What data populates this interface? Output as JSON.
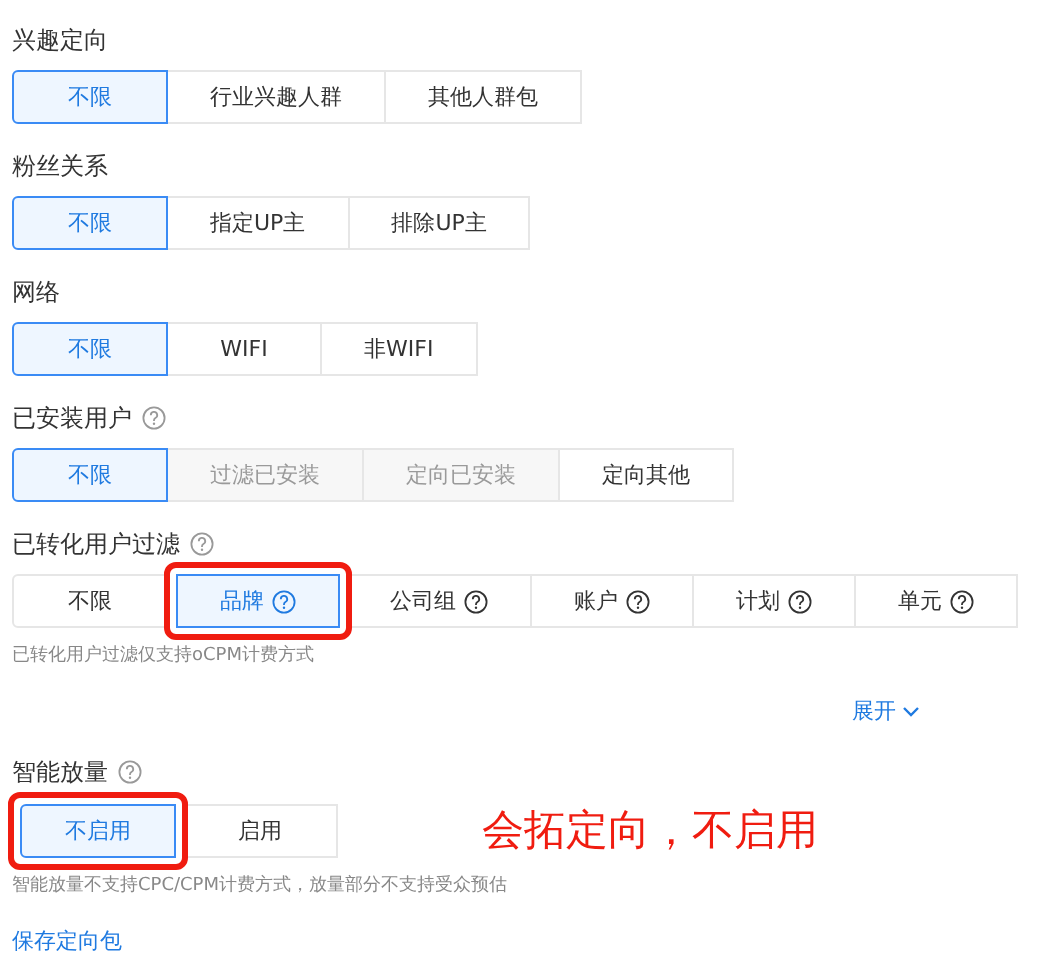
{
  "sections": [
    {
      "title": "兴趣定向",
      "help": false,
      "options": [
        {
          "label": "不限",
          "selected": true,
          "disabled": false,
          "help": false,
          "annotated": false
        },
        {
          "label": "行业兴趣人群",
          "selected": false,
          "disabled": false,
          "help": false,
          "annotated": false
        },
        {
          "label": "其他人群包",
          "selected": false,
          "disabled": false,
          "help": false,
          "annotated": false
        }
      ]
    },
    {
      "title": "粉丝关系",
      "help": false,
      "options": [
        {
          "label": "不限",
          "selected": true,
          "disabled": false,
          "help": false,
          "annotated": false
        },
        {
          "label": "指定UP主",
          "selected": false,
          "disabled": false,
          "help": false,
          "annotated": false
        },
        {
          "label": "排除UP主",
          "selected": false,
          "disabled": false,
          "help": false,
          "annotated": false
        }
      ]
    },
    {
      "title": "网络",
      "help": false,
      "options": [
        {
          "label": "不限",
          "selected": true,
          "disabled": false,
          "help": false,
          "annotated": false
        },
        {
          "label": "WIFI",
          "selected": false,
          "disabled": false,
          "help": false,
          "annotated": false
        },
        {
          "label": "非WIFI",
          "selected": false,
          "disabled": false,
          "help": false,
          "annotated": false
        }
      ]
    },
    {
      "title": "已安装用户",
      "help": true,
      "options": [
        {
          "label": "不限",
          "selected": true,
          "disabled": false,
          "help": false,
          "annotated": false
        },
        {
          "label": "过滤已安装",
          "selected": false,
          "disabled": true,
          "help": false,
          "annotated": false
        },
        {
          "label": "定向已安装",
          "selected": false,
          "disabled": true,
          "help": false,
          "annotated": false
        },
        {
          "label": "定向其他",
          "selected": false,
          "disabled": false,
          "help": false,
          "annotated": false
        }
      ]
    },
    {
      "title": "已转化用户过滤",
      "help": true,
      "options": [
        {
          "label": "不限",
          "selected": false,
          "disabled": false,
          "help": false,
          "annotated": false
        },
        {
          "label": "品牌",
          "selected": true,
          "disabled": false,
          "help": true,
          "annotated": true
        },
        {
          "label": "公司组",
          "selected": false,
          "disabled": false,
          "help": true,
          "annotated": false
        },
        {
          "label": "账户",
          "selected": false,
          "disabled": false,
          "help": true,
          "annotated": false
        },
        {
          "label": "计划",
          "selected": false,
          "disabled": false,
          "help": true,
          "annotated": false
        },
        {
          "label": "单元",
          "selected": false,
          "disabled": false,
          "help": true,
          "annotated": false
        }
      ],
      "hint": "已转化用户过滤仅支持oCPM计费方式",
      "expand": "展开"
    },
    {
      "title": "智能放量",
      "help": true,
      "options": [
        {
          "label": "不启用",
          "selected": true,
          "disabled": false,
          "help": false,
          "annotated": true
        },
        {
          "label": "启用",
          "selected": false,
          "disabled": false,
          "help": false,
          "annotated": false
        }
      ],
      "note": "会拓定向，不启用",
      "hint": "智能放量不支持CPC/CPM计费方式，放量部分不支持受众预估"
    }
  ],
  "save_link": "保存定向包"
}
